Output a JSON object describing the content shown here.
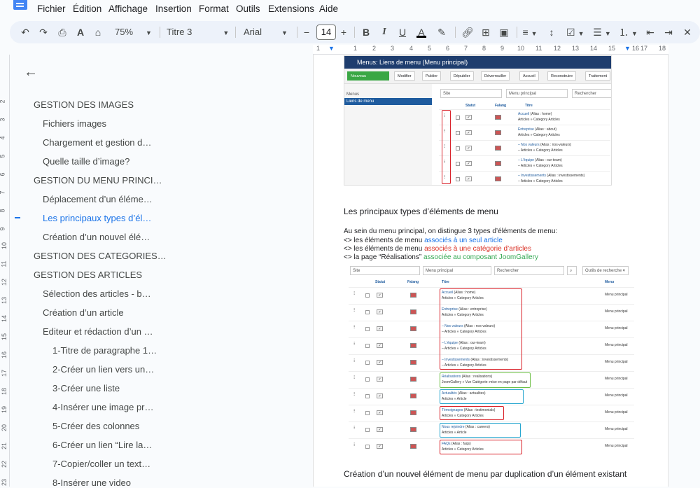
{
  "menu": [
    "Fichier",
    "Édition",
    "Affichage",
    "Insertion",
    "Format",
    "Outils",
    "Extensions",
    "Aide"
  ],
  "toolbar": {
    "zoom": "75%",
    "style": "Titre 3",
    "font": "Arial",
    "size": "14"
  },
  "ruler_h": [
    "1",
    "1",
    "2",
    "3",
    "4",
    "5",
    "6",
    "7",
    "8",
    "9",
    "10",
    "11",
    "12",
    "13",
    "14",
    "15",
    "16",
    "17",
    "18"
  ],
  "ruler_v": [
    "2",
    "3",
    "4",
    "5",
    "6",
    "7",
    "8",
    "9",
    "10",
    "11",
    "12",
    "13",
    "14",
    "15",
    "16",
    "17",
    "18",
    "19",
    "20",
    "21",
    "22",
    "23",
    "24",
    "25"
  ],
  "outline": [
    {
      "label": "GESTION DES IMAGES",
      "level": 1
    },
    {
      "label": "Fichiers images",
      "level": 2
    },
    {
      "label": "Chargement et gestion d…",
      "level": 2
    },
    {
      "label": "Quelle taille d’image?",
      "level": 2
    },
    {
      "label": "GESTION DU MENU PRINCI…",
      "level": 1
    },
    {
      "label": "Déplacement d’un éléme…",
      "level": 2
    },
    {
      "label": "Les principaux types d’él…",
      "level": 2,
      "active": true
    },
    {
      "label": "Création d’un nouvel élé…",
      "level": 2
    },
    {
      "label": "GESTION DES CATEGORIES…",
      "level": 1
    },
    {
      "label": "GESTION DES ARTICLES",
      "level": 1
    },
    {
      "label": "Sélection des articles - b…",
      "level": 2
    },
    {
      "label": "Création d’un article",
      "level": 2
    },
    {
      "label": "Editeur et rédaction d’un …",
      "level": 2
    },
    {
      "label": "1-Titre de paragraphe 1…",
      "level": 3
    },
    {
      "label": "2-Créer un lien vers un…",
      "level": 3
    },
    {
      "label": "3-Créer une liste",
      "level": 3
    },
    {
      "label": "4-Insérer une image pr…",
      "level": 3
    },
    {
      "label": "5-Créer des colonnes",
      "level": 3
    },
    {
      "label": "6-Créer un lien “Lire la…",
      "level": 3
    },
    {
      "label": "7-Copier/coller un text…",
      "level": 3
    },
    {
      "label": "8-Insérer une video",
      "level": 3
    }
  ],
  "ss1": {
    "title": "Menus: Liens de menu (Menu principal)",
    "buttons": [
      "Nouveau",
      "Modifier",
      "Publier",
      "Dépublier",
      "Déverrouiller",
      "Accueil",
      "Reconstruire",
      "Traitement"
    ],
    "side_title": "Menus",
    "side_active": "Liens de menu",
    "filters": [
      "Site",
      "Menu principal",
      "Rechercher"
    ],
    "cols": [
      "Statut",
      "Falang",
      "Titre"
    ],
    "rows": [
      {
        "title": "Accueil",
        "alias": "(Alias : home)",
        "sub": "Articles » Category Articles"
      },
      {
        "title": "Entreprise",
        "alias": "(Alias : about)",
        "sub": "Articles » Category Articles"
      },
      {
        "title": "– Nos valeurs",
        "alias": "(Alias : nos-valeurs)",
        "sub": "– Articles » Category Articles"
      },
      {
        "title": "– L'équipe",
        "alias": "(Alias : our-team)",
        "sub": "– Articles » Category Articles"
      },
      {
        "title": "– Investissements",
        "alias": "(Alias : investissements)",
        "sub": "– Articles » Category Articles"
      }
    ]
  },
  "heading1": "Les principaux types d’éléments de menu",
  "intro": "Au sein du menu principal, on distingue 3 types d’éléments de menu:",
  "bullets": [
    {
      "pre": "<> les éléments de menu ",
      "hl": "associés à un seul article",
      "color": "#1a73e8"
    },
    {
      "pre": "<> les éléments de menu ",
      "hl": "associés à une catégorie d’articles",
      "color": "#d93025"
    },
    {
      "pre": "<> la page “Réalisations” ",
      "hl": "associée au composant JoomGallery",
      "color": "#34a853"
    }
  ],
  "ss2": {
    "filters": [
      "Site",
      "Menu principal",
      "Rechercher",
      "Outils de recherche ▾"
    ],
    "cols": [
      "Statut",
      "Falang",
      "Titre",
      "Menu"
    ],
    "menu_label": "Menu principal",
    "rows": [
      {
        "title": "Accueil",
        "alias": "(Alias : home)",
        "sub": "Articles » Category Articles"
      },
      {
        "title": "Entreprise",
        "alias": "(Alias : entreprise)",
        "sub": "Articles » Category Articles"
      },
      {
        "title": "– Nos valeurs",
        "alias": "(Alias : nos-valeurs)",
        "sub": "– Articles » Category Articles"
      },
      {
        "title": "– L'équipe",
        "alias": "(Alias : our-team)",
        "sub": "– Articles » Category Articles"
      },
      {
        "title": "– Investissements",
        "alias": "(Alias : investissements)",
        "sub": "– Articles » Category Articles"
      },
      {
        "title": "Réalisations",
        "alias": "(Alias : realisations)",
        "sub": "JoomGallery » Vue Catégorie: mise en page par défaut"
      },
      {
        "title": "Actualités",
        "alias": "(Alias : actualites)",
        "sub": "Articles » Article"
      },
      {
        "title": "Témoignages",
        "alias": "(Alias : testimonials)",
        "sub": "Articles » Category Articles"
      },
      {
        "title": "Nous rejoindre",
        "alias": "(Alias : careers)",
        "sub": "Articles » Article"
      },
      {
        "title": "FAQs",
        "alias": "(Alias : faqs)",
        "sub": "Articles » Category Articles"
      }
    ]
  },
  "heading2": "Création d’un nouvel élément de menu par duplication d’un élément existant"
}
